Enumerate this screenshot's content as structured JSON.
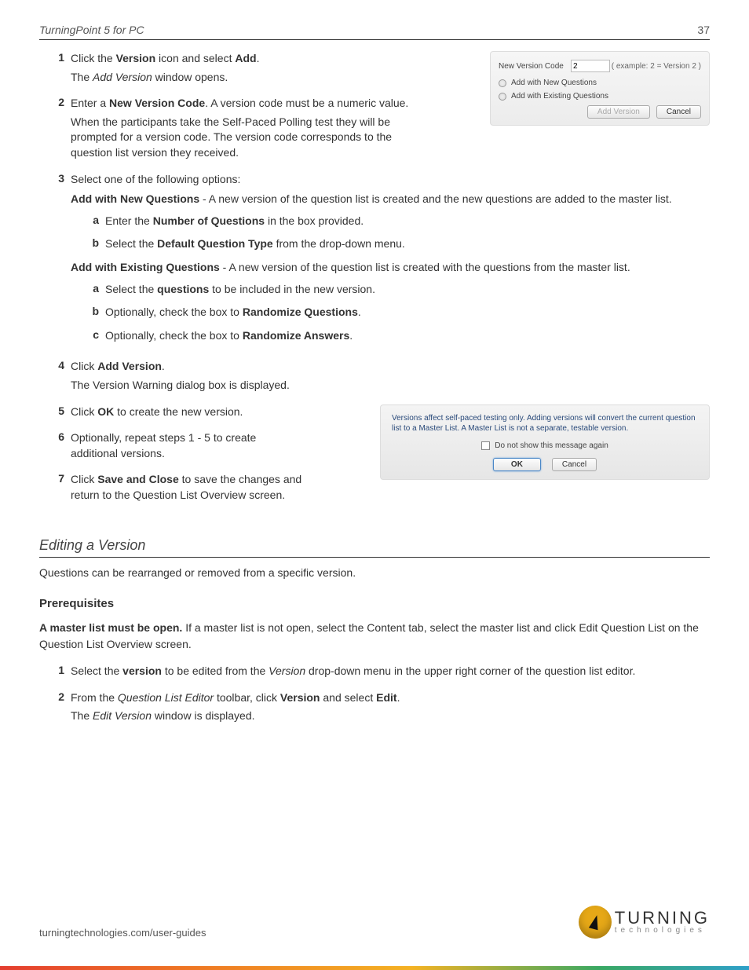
{
  "header": {
    "title": "TurningPoint 5 for PC",
    "page": "37"
  },
  "steps": [
    {
      "n": "1",
      "lines": [
        [
          {
            "t": "Click the "
          },
          {
            "t": "Version",
            "b": true
          },
          {
            "t": " icon and select "
          },
          {
            "t": "Add",
            "b": true
          },
          {
            "t": "."
          }
        ],
        [
          {
            "t": "The "
          },
          {
            "t": "Add Version",
            "i": true
          },
          {
            "t": " window opens."
          }
        ]
      ]
    },
    {
      "n": "2",
      "lines": [
        [
          {
            "t": "Enter a "
          },
          {
            "t": "New Version Code",
            "b": true
          },
          {
            "t": ". A version code must be a numeric value."
          }
        ],
        [
          {
            "t": "When the participants take the Self-Paced Polling test they will be prompted for a version code. The version code corresponds to the question list version they received."
          }
        ]
      ]
    },
    {
      "n": "3",
      "lines": [
        [
          {
            "t": "Select one of the following options:"
          }
        ]
      ],
      "group_a": {
        "head": [
          {
            "t": "Add with New Questions",
            "b": true
          },
          {
            "t": " - A new version of the question list is created and the new questions are added to the master list."
          }
        ],
        "items": [
          {
            "m": "a",
            "line": [
              {
                "t": "Enter the "
              },
              {
                "t": "Number of Questions",
                "b": true
              },
              {
                "t": " in the box provided."
              }
            ]
          },
          {
            "m": "b",
            "line": [
              {
                "t": "Select the "
              },
              {
                "t": "Default Question Type",
                "b": true
              },
              {
                "t": " from the drop-down menu."
              }
            ]
          }
        ]
      },
      "group_b": {
        "head": [
          {
            "t": "Add with Existing Questions",
            "b": true
          },
          {
            "t": " - A new version of the question list is created with the questions from the master list."
          }
        ],
        "items": [
          {
            "m": "a",
            "line": [
              {
                "t": "Select the "
              },
              {
                "t": "questions",
                "b": true
              },
              {
                "t": " to be included in the new version."
              }
            ]
          },
          {
            "m": "b",
            "line": [
              {
                "t": "Optionally, check the box to "
              },
              {
                "t": "Randomize Questions",
                "b": true
              },
              {
                "t": "."
              }
            ]
          },
          {
            "m": "c",
            "line": [
              {
                "t": "Optionally, check the box to "
              },
              {
                "t": "Randomize Answers",
                "b": true
              },
              {
                "t": "."
              }
            ]
          }
        ]
      }
    },
    {
      "n": "4",
      "lines": [
        [
          {
            "t": "Click "
          },
          {
            "t": "Add Version",
            "b": true
          },
          {
            "t": "."
          }
        ],
        [
          {
            "t": "The Version Warning dialog box is displayed."
          }
        ]
      ]
    },
    {
      "n": "5",
      "lines": [
        [
          {
            "t": "Click "
          },
          {
            "t": "OK",
            "b": true
          },
          {
            "t": " to create the new version."
          }
        ]
      ]
    },
    {
      "n": "6",
      "lines": [
        [
          {
            "t": "Optionally, repeat steps 1 - 5 to create additional versions."
          }
        ]
      ]
    },
    {
      "n": "7",
      "lines": [
        [
          {
            "t": "Click "
          },
          {
            "t": "Save and Close",
            "b": true
          },
          {
            "t": " to save the changes and return to the  Question List Overview screen."
          }
        ]
      ]
    }
  ],
  "dialog1": {
    "code_label": "New Version Code",
    "code_value": "2",
    "example": "( example: 2 = Version 2 )",
    "opt1": "Add with New Questions",
    "opt2": "Add with Existing Questions",
    "btn_add": "Add Version",
    "btn_cancel": "Cancel"
  },
  "dialog2": {
    "msg": "Versions affect self-paced testing only.  Adding versions will convert the current question list to a Master List.  A Master List is not a separate, testable version.",
    "chk": "Do not show this message again",
    "btn_ok": "OK",
    "btn_cancel": "Cancel"
  },
  "section_edit": {
    "title": "Editing a Version",
    "intro": "Questions can be rearranged or removed from a specific version.",
    "prereq_title": "Prerequisites",
    "prereq": [
      {
        "t": "A master list must be open.",
        "b": true
      },
      {
        "t": " If a master list is not open, select the Content tab, select the master list and click Edit Question List on the Question List Overview screen."
      }
    ],
    "steps": [
      {
        "n": "1",
        "lines": [
          [
            {
              "t": "Select the "
            },
            {
              "t": "version",
              "b": true
            },
            {
              "t": " to be edited from the "
            },
            {
              "t": "Version",
              "i": true
            },
            {
              "t": " drop-down menu in the upper right corner of the question list editor."
            }
          ]
        ]
      },
      {
        "n": "2",
        "lines": [
          [
            {
              "t": "From the "
            },
            {
              "t": "Question List Editor",
              "i": true
            },
            {
              "t": " toolbar, click "
            },
            {
              "t": "Version",
              "b": true
            },
            {
              "t": " and select "
            },
            {
              "t": "Edit",
              "b": true
            },
            {
              "t": "."
            }
          ],
          [
            {
              "t": "The "
            },
            {
              "t": "Edit Version",
              "i": true
            },
            {
              "t": " window is displayed."
            }
          ]
        ]
      }
    ]
  },
  "footer": {
    "url": "turningtechnologies.com/user-guides",
    "brand1": "TURNING",
    "brand2": "technologies"
  }
}
